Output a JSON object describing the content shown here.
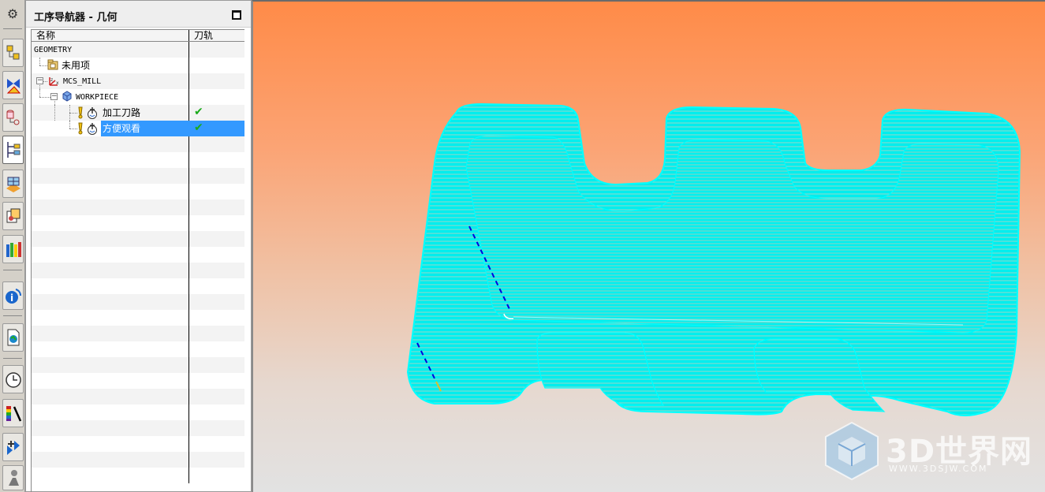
{
  "navigator": {
    "title": "工序导航器 - 几何",
    "columns": {
      "name": "名称",
      "toolpath": "刀轨"
    },
    "rows": [
      {
        "name": "GEOMETRY",
        "toolpath": ""
      },
      {
        "name": "未用项",
        "toolpath": ""
      },
      {
        "name": "MCS_MILL",
        "toolpath": ""
      },
      {
        "name": "WORKPIECE",
        "toolpath": ""
      },
      {
        "name": "加工刀路",
        "toolpath": "✔"
      },
      {
        "name": "方便观看",
        "toolpath": "✔",
        "selected": true
      }
    ]
  },
  "resource_bar": {
    "items": [
      "settings-icon",
      "assembly-navigator-icon",
      "constraint-navigator-icon",
      "part-navigator-icon",
      "operation-navigator-icon",
      "machine-tool-icon",
      "reuse-library-icon",
      "hd3d-icon",
      "information-icon",
      "web-browser-icon",
      "history-icon",
      "system-materials-icon",
      "process-studio-icon",
      "roles-icon"
    ]
  },
  "watermark": {
    "brand": "3D世界网",
    "url": "WWW.3DSJW.COM"
  },
  "colors": {
    "toolpath": "#00f0f0",
    "selection": "#3399ff",
    "check": "#1aaa1a",
    "engage": "#0000dd"
  }
}
